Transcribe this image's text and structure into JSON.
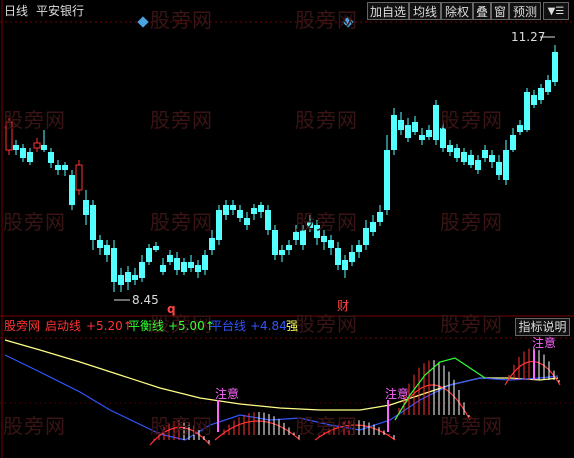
{
  "title": {
    "period": "日线",
    "stock": "平安银行"
  },
  "toolbar": {
    "add": "加自选",
    "ma": "均线",
    "rights": "除权",
    "overlay": "叠",
    "window": "窗",
    "forecast": "预测"
  },
  "upper_chart": {
    "max_label": "11.27",
    "min_label": "8.45",
    "marker_q": "q",
    "marker_cai": "财"
  },
  "indicator": {
    "name": "股旁网",
    "items": [
      {
        "label": "启动线",
        "value": "+5.20↑",
        "color": "#ff3333"
      },
      {
        "label": "平衡线",
        "value": "+5.00↑",
        "color": "#33ff33"
      },
      {
        "label": "平台线",
        "value": "+4.84",
        "color": "#3355ff"
      }
    ],
    "strong": "强",
    "help_button": "指标说明",
    "notes": [
      "注意",
      "注意",
      "注意"
    ]
  },
  "watermark": "股旁网",
  "colors": {
    "up": "#ff3333",
    "down": "#54ffff",
    "bg": "#000000",
    "grid": "#7a0000"
  }
}
